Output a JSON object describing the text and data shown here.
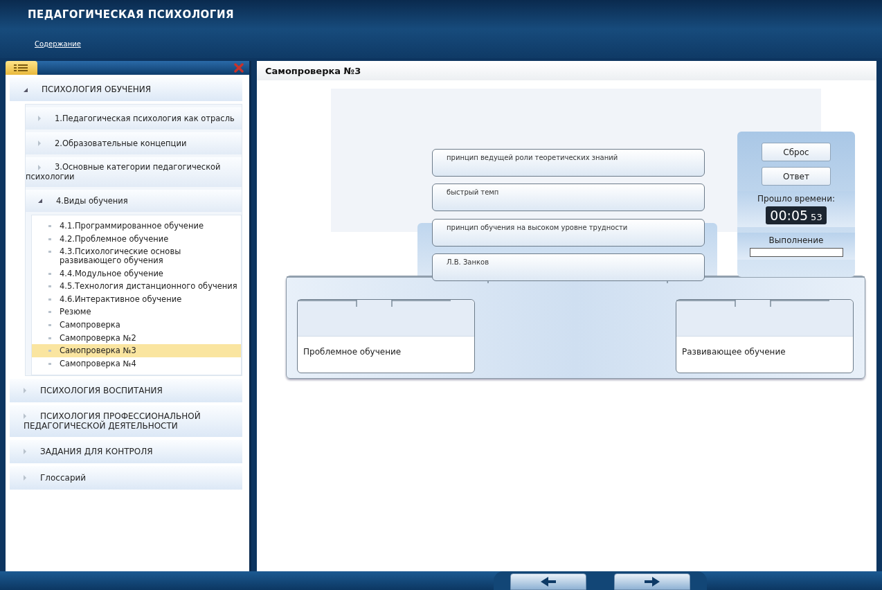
{
  "app": {
    "title": "ПЕДАГОГИЧЕСКАЯ ПСИХОЛОГИЯ"
  },
  "menu": [
    {
      "label": "Содержание"
    }
  ],
  "sidebar": {
    "items": [
      {
        "label": "ПСИХОЛОГИЯ ОБУЧЕНИЯ",
        "expanded": true,
        "children": [
          {
            "label": "1.Педагогическая психология как отрасль",
            "expanded": false
          },
          {
            "label": "2.Образовательные концепции",
            "expanded": false
          },
          {
            "label": "3.Основные категории педагогической психологии",
            "expanded": false
          },
          {
            "label": "4.Виды обучения",
            "expanded": true,
            "children": [
              {
                "label": "4.1.Программированное обучение",
                "selected": false
              },
              {
                "label": "4.2.Проблемное обучение",
                "selected": false
              },
              {
                "label": "4.3.Психологические основы развивающего обучения",
                "selected": false
              },
              {
                "label": "4.4.Модульное обучение",
                "selected": false
              },
              {
                "label": "4.5.Технология дистанционного обучения",
                "selected": false
              },
              {
                "label": "4.6.Интерактивное обучение",
                "selected": false
              },
              {
                "label": "Резюме",
                "selected": false
              },
              {
                "label": "Самопроверка",
                "selected": false
              },
              {
                "label": "Самопроверка №2",
                "selected": false
              },
              {
                "label": "Самопроверка №3",
                "selected": true
              },
              {
                "label": "Самопроверка №4",
                "selected": false
              }
            ]
          }
        ]
      },
      {
        "label": "ПСИХОЛОГИЯ ВОСПИТАНИЯ",
        "expanded": false
      },
      {
        "label": "ПСИХОЛОГИЯ ПРОФЕССИОНАЛЬНОЙ ПЕДАГОГИЧЕСКОЙ ДЕЯТЕЛЬНОСТИ",
        "expanded": false
      },
      {
        "label": "ЗАДАНИЯ ДЛЯ КОНТРОЛЯ",
        "expanded": false
      },
      {
        "label": "Глоссарий",
        "expanded": false
      }
    ]
  },
  "content": {
    "title": "Самопроверка №3"
  },
  "exercise": {
    "cards": [
      {
        "label": "принцип ведущей роли теоретических знаний"
      },
      {
        "label": "быстрый темп"
      },
      {
        "label": "принцип обучения на высоком уровне трудности"
      },
      {
        "label": "Л.В. Занков"
      }
    ],
    "targets": [
      {
        "label": "Проблемное обучение"
      },
      {
        "label": "Развивающее обучение"
      }
    ],
    "buttons": [
      {
        "label": "Сброс"
      },
      {
        "label": "Ответ"
      }
    ],
    "timer": {
      "label": "Прошло времени:",
      "time": "00:05",
      "seconds": "53"
    },
    "progress": {
      "label": "Выполнение",
      "level": 0
    }
  }
}
